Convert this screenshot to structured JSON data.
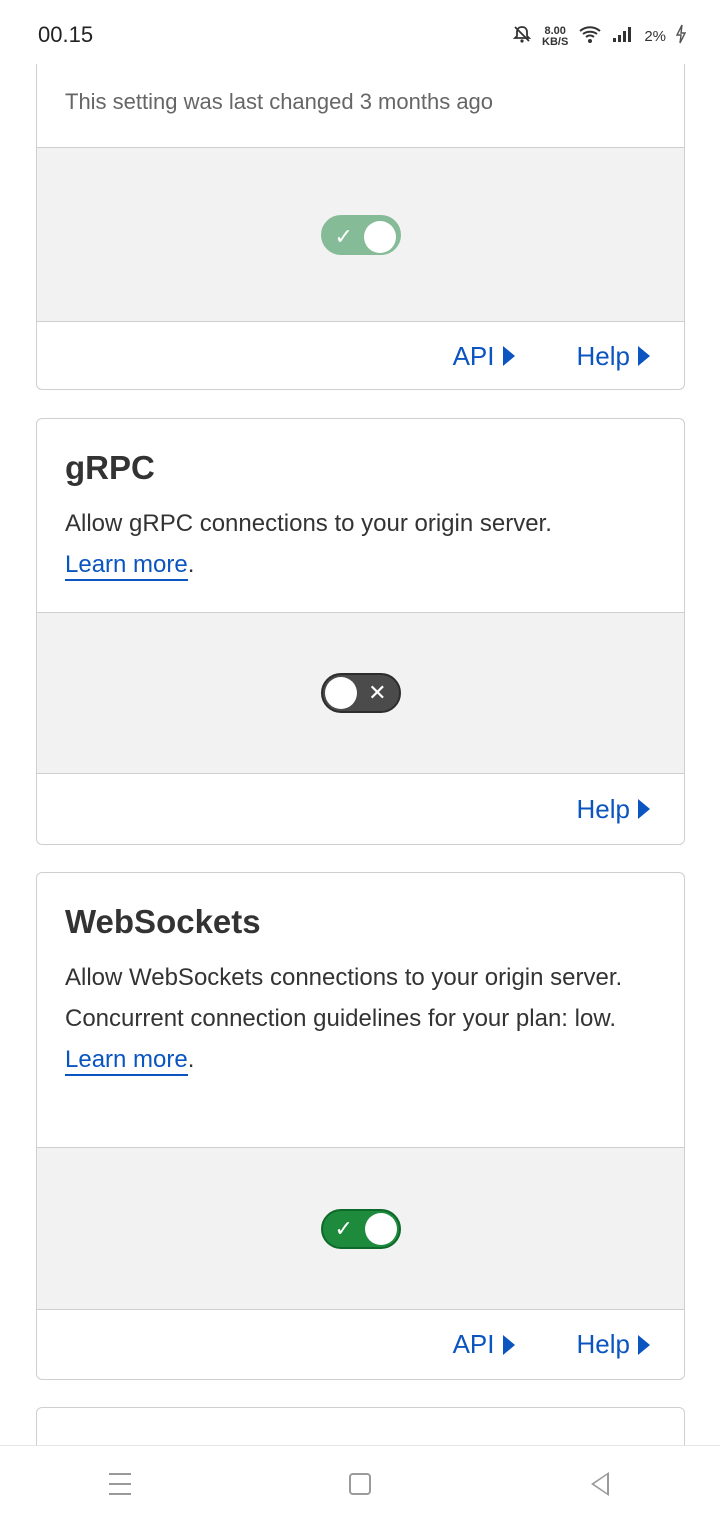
{
  "statusbar": {
    "time": "00.15",
    "speed_top": "8.00",
    "speed_unit": "KB/S",
    "battery": "2%"
  },
  "cards": [
    {
      "meta": "This setting was last changed 3 months ago",
      "toggle_state": "on",
      "links": {
        "api": "API",
        "help": "Help"
      }
    },
    {
      "title": "gRPC",
      "description": "Allow gRPC connections to your origin server.",
      "learn_more": "Learn more",
      "toggle_state": "off",
      "links": {
        "help": "Help"
      }
    },
    {
      "title": "WebSockets",
      "description_line1": "Allow WebSockets connections to your origin server.",
      "description_line2_prefix": "Concurrent connection guidelines for your plan:",
      "description_line2_value": "low.",
      "learn_more": "Learn more",
      "toggle_state": "on",
      "links": {
        "api": "API",
        "help": "Help"
      }
    }
  ],
  "colors": {
    "link": "#0b55c1",
    "toggle_on_light": "#86bb98",
    "toggle_on": "#1e8a3b",
    "toggle_off": "#4b4b4b"
  }
}
